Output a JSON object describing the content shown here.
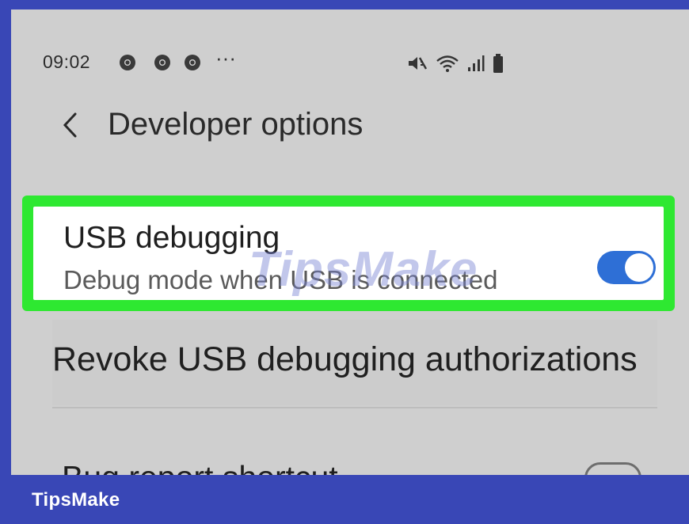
{
  "status_bar": {
    "time": "09:02",
    "notification_icons": [
      "chrome-icon",
      "chrome-icon",
      "chrome-icon"
    ],
    "more": "···",
    "right_icons": [
      "mute-icon",
      "wifi-icon",
      "signal-icon",
      "battery-icon"
    ]
  },
  "header": {
    "back_glyph": "<",
    "title": "Developer options"
  },
  "settings": {
    "usb_debugging": {
      "title": "USB debugging",
      "subtitle": "Debug mode when USB is connected",
      "enabled": true
    },
    "revoke": {
      "label": "Revoke USB debugging authorizations"
    },
    "bug_report": {
      "label": "Bug report shortcut",
      "enabled": false
    }
  },
  "watermark": "TipsMake",
  "footer": {
    "brand": "TipsMake"
  },
  "colors": {
    "frame": "#3947b6",
    "highlight": "#2ee831",
    "toggle_on": "#2e6fd6",
    "screen_bg": "#cfcfcf"
  }
}
